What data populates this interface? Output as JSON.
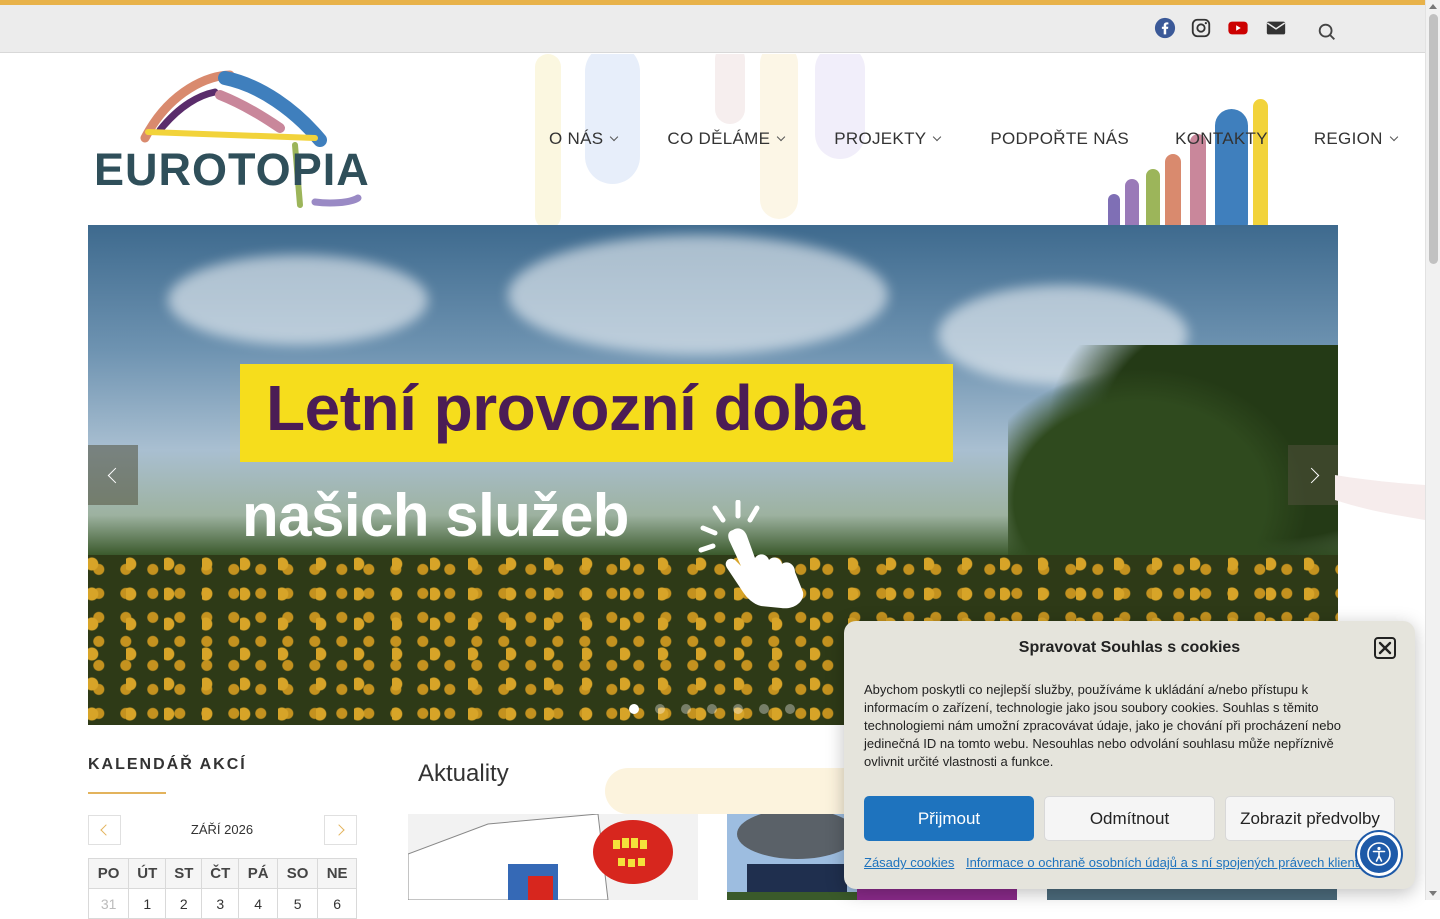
{
  "social": {
    "icons": [
      "facebook-icon",
      "instagram-icon",
      "youtube-icon",
      "email-icon",
      "search-icon"
    ],
    "colors": {
      "facebook": "#3b5998",
      "instagram": "#333333",
      "youtube": "#cc0000",
      "email": "#333333"
    }
  },
  "logo": {
    "text": "EUROTOPIA"
  },
  "nav": {
    "items": [
      {
        "label": "O NÁS",
        "dropdown": true
      },
      {
        "label": "CO DĚLÁME",
        "dropdown": true
      },
      {
        "label": "PROJEKTY",
        "dropdown": true
      },
      {
        "label": "PODPOŘTE NÁS",
        "dropdown": false
      },
      {
        "label": "KONTAKTY",
        "dropdown": false
      },
      {
        "label": "REGION",
        "dropdown": true
      }
    ]
  },
  "slider": {
    "title": "Letní provozní doba",
    "subtitle": "našich služeb",
    "dot_count": 7,
    "active_dot": 1
  },
  "calendar": {
    "heading": "KALENDÁŘ AKCÍ",
    "month": "ZÁŘÍ 2026",
    "weekdays": [
      "PO",
      "ÚT",
      "ST",
      "ČT",
      "PÁ",
      "SO",
      "NE"
    ],
    "first_row": [
      "31",
      "1",
      "2",
      "3",
      "4",
      "5",
      "6"
    ]
  },
  "news": {
    "heading": "Aktuality"
  },
  "cookie": {
    "title": "Spravovat Souhlas s cookies",
    "body": "Abychom poskytli co nejlepší služby, používáme k ukládání a/nebo přístupu k informacím o zařízení, technologie jako jsou soubory cookies. Souhlas s těmito technologiemi nám umožní zpracovávat údaje, jako je chování při procházení nebo jedinečná ID na tomto webu. Nesouhlas nebo odvolání souhlasu může nepříznivě ovlivnit určité vlastnosti a funkce.",
    "accept": "Přijmout",
    "deny": "Odmítnout",
    "preferences": "Zobrazit předvolby",
    "link_policy": "Zásady cookies",
    "link_privacy": "Informace o ochraně osobních údajů a s ní spojených právech klientů"
  },
  "colors": {
    "accent": "#e8b24a",
    "brand_dark": "#2f4f5a",
    "button_blue": "#1e73be",
    "banner_purple": "#4b1d55",
    "banner_yellow": "#f6dd1c"
  }
}
